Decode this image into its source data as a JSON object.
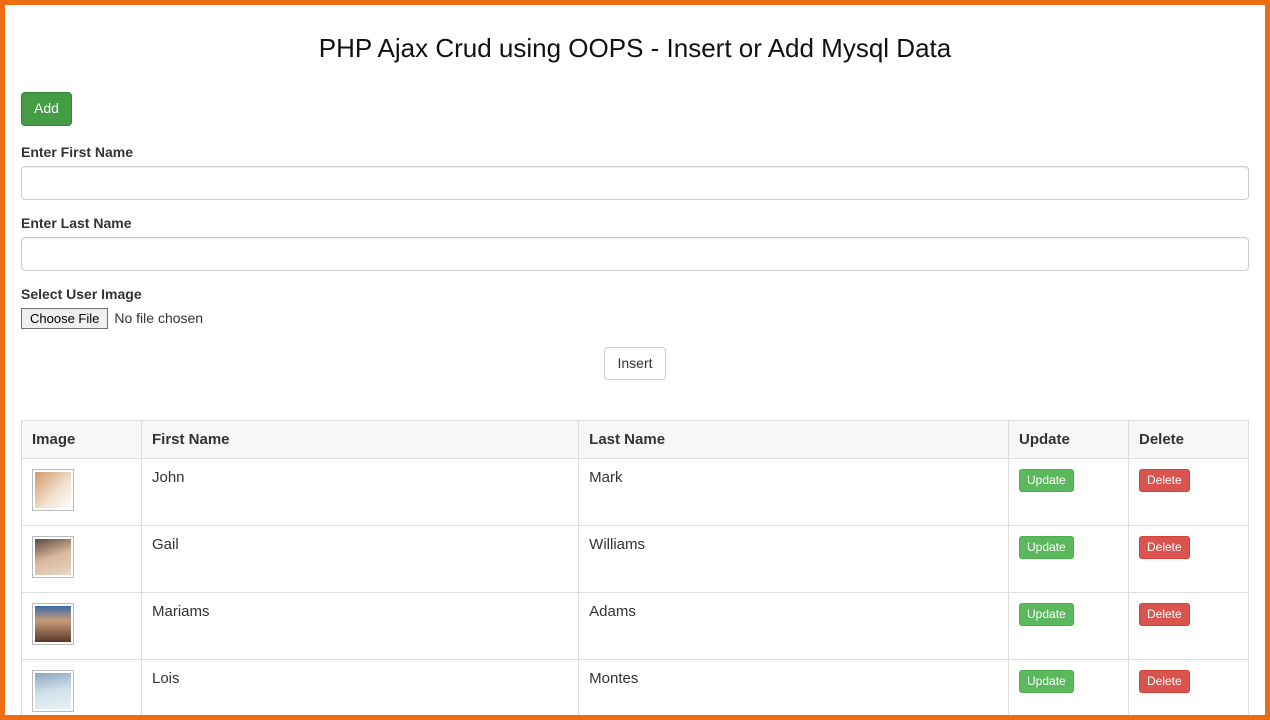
{
  "title": "PHP Ajax Crud using OOPS - Insert or Add Mysql Data",
  "buttons": {
    "add": "Add",
    "insert": "Insert",
    "choose_file": "Choose File",
    "update": "Update",
    "delete": "Delete"
  },
  "form": {
    "first_name_label": "Enter First Name",
    "last_name_label": "Enter Last Name",
    "image_label": "Select User Image",
    "file_status": "No file chosen",
    "first_name_value": "",
    "last_name_value": ""
  },
  "table": {
    "headers": {
      "image": "Image",
      "first_name": "First Name",
      "last_name": "Last Name",
      "update": "Update",
      "delete": "Delete"
    },
    "rows": [
      {
        "first_name": "John",
        "last_name": "Mark",
        "avatar_class": "av1"
      },
      {
        "first_name": "Gail",
        "last_name": "Williams",
        "avatar_class": "av2"
      },
      {
        "first_name": "Mariams",
        "last_name": "Adams",
        "avatar_class": "av3"
      },
      {
        "first_name": "Lois",
        "last_name": "Montes",
        "avatar_class": "av4"
      }
    ]
  }
}
